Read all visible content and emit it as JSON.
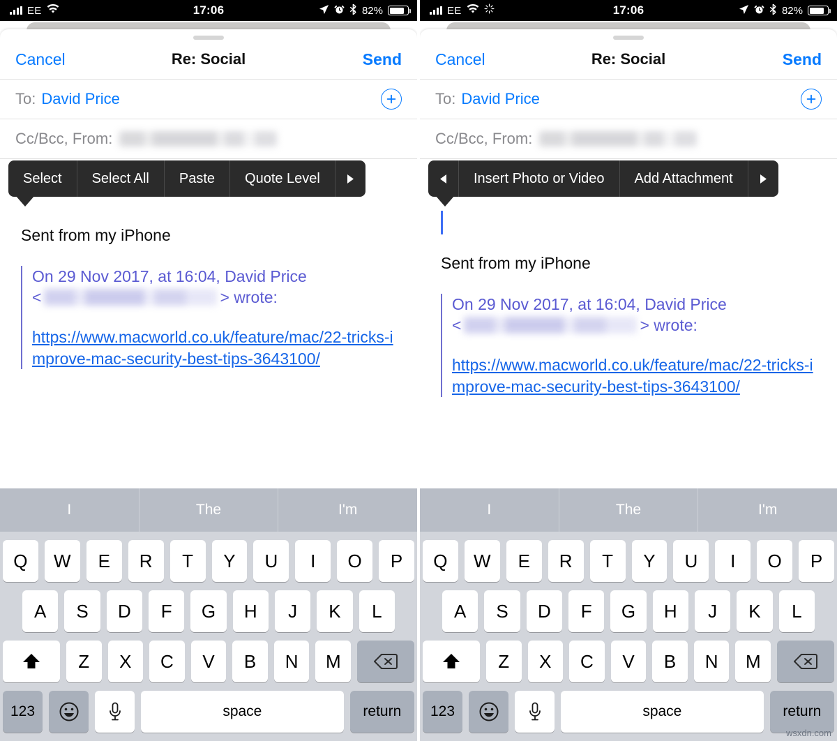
{
  "watermark": "wsxdn.com",
  "status_bar": {
    "carrier": "EE",
    "time": "17:06",
    "battery_percent": "82%",
    "icons_left": [
      "signal-bars-icon",
      "wifi-icon"
    ],
    "icons_left_right_panel": [
      "signal-bars-icon",
      "wifi-icon",
      "activity-spinner-icon"
    ],
    "icons_right": [
      "location-arrow-icon",
      "alarm-clock-icon",
      "bluetooth-icon",
      "battery-icon"
    ]
  },
  "nav": {
    "cancel": "Cancel",
    "title": "Re: Social",
    "send": "Send"
  },
  "fields": {
    "to_label": "To:",
    "to_value": "David Price",
    "ccbcc_label": "Cc/Bcc, From:",
    "ccbcc_value_redacted": true,
    "add_button": "add-recipient-button"
  },
  "left_panel": {
    "menu_items": [
      "Select",
      "Select All",
      "Paste",
      "Quote Level",
      "▶"
    ],
    "menu_item_names": [
      "select",
      "select-all",
      "paste",
      "quote-level",
      "next-page"
    ],
    "has_caret": false
  },
  "right_panel": {
    "menu_items": [
      "◀",
      "Insert Photo or Video",
      "Add Attachment",
      "▶"
    ],
    "menu_item_names": [
      "prev-page",
      "insert-photo-or-video",
      "add-attachment",
      "next-page"
    ],
    "has_caret": true
  },
  "message": {
    "signature": "Sent from my iPhone",
    "quote_line1": "On 29 Nov 2017, at 16:04, David Price",
    "quote_bracket_open": "<",
    "quote_bracket_close": "> wrote:",
    "link": "https://www.macworld.co.uk/feature/mac/22-tricks-improve-mac-security-best-tips-3643100/"
  },
  "keyboard": {
    "predictions": [
      "I",
      "The",
      "I'm"
    ],
    "row1": [
      "Q",
      "W",
      "E",
      "R",
      "T",
      "Y",
      "U",
      "I",
      "O",
      "P"
    ],
    "row2": [
      "A",
      "S",
      "D",
      "F",
      "G",
      "H",
      "J",
      "K",
      "L"
    ],
    "row3": [
      "Z",
      "X",
      "C",
      "V",
      "B",
      "N",
      "M"
    ],
    "shift": "shift-key",
    "delete": "delete-key",
    "numbers": "123",
    "emoji": "emoji-key",
    "dictation": "microphone-key",
    "space": "space",
    "return": "return"
  },
  "colors": {
    "accent_blue": "#067aff",
    "link_blue": "#1565e8",
    "quote_purple": "#5a5ad2",
    "menu_dark": "#2b2b2b",
    "keyboard_bg": "#d2d5db",
    "predict_bg": "#b8bdc6",
    "key_grey": "#a9b0bb"
  }
}
